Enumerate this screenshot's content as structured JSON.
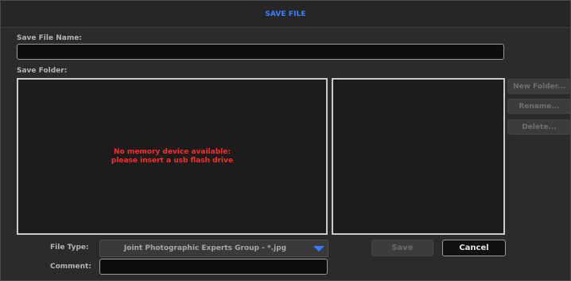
{
  "dialog": {
    "title": "SAVE FILE"
  },
  "file_name": {
    "label": "Save File Name:",
    "value": ""
  },
  "folder": {
    "label": "Save Folder:",
    "empty_message_line1": "No memory device available:",
    "empty_message_line2": "please insert a usb flash drive"
  },
  "side_buttons": {
    "new_folder": "New Folder...",
    "rename": "Rename...",
    "delete": "Delete..."
  },
  "file_type": {
    "label": "File Type:",
    "selected": "Joint Photographic Experts Group - *.jpg",
    "arrow_icon": "triangle-down-icon"
  },
  "comment": {
    "label": "Comment:",
    "value": ""
  },
  "actions": {
    "save": "Save",
    "cancel": "Cancel"
  },
  "colors": {
    "title": "#3a80ff",
    "error": "#ff2a2a",
    "dropdown_arrow": "#2f7cff"
  }
}
